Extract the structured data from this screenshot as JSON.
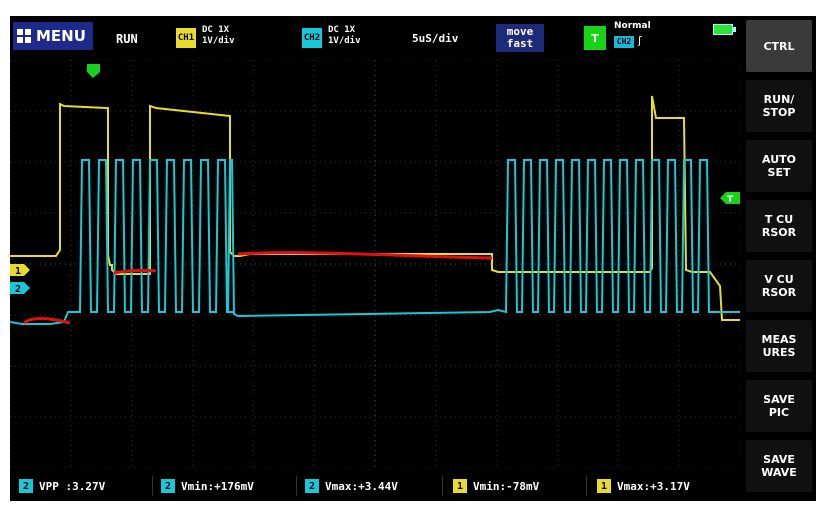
{
  "header": {
    "menu_label": "MENU",
    "run_state": "RUN",
    "ch1": {
      "tag": "CH1",
      "coupling": "DC  1X",
      "scale": "1V/div"
    },
    "ch2": {
      "tag": "CH2",
      "coupling": "DC  1X",
      "scale": "1V/div"
    },
    "timebase": "5uS/div",
    "move": {
      "line1": "move",
      "line2": "fast"
    },
    "trigger": {
      "icon": "T",
      "mode": "Normal",
      "source": "CH2",
      "edge": "ʃ"
    }
  },
  "sidebar": {
    "items": [
      {
        "label": "CTRL"
      },
      {
        "label": "RUN/\nSTOP"
      },
      {
        "label": "AUTO\nSET"
      },
      {
        "label": "T CU\nRSOR"
      },
      {
        "label": "V CU\nRSOR"
      },
      {
        "label": "MEAS\nURES"
      },
      {
        "label": "SAVE\nPIC"
      },
      {
        "label": "SAVE\nWAVE"
      }
    ]
  },
  "markers": {
    "ch1": "1",
    "ch2": "2",
    "trig_level": "T"
  },
  "measurements": [
    {
      "ch": "2",
      "text": "VPP :3.27V"
    },
    {
      "ch": "2",
      "text": "Vmin:+176mV"
    },
    {
      "ch": "2",
      "text": "Vmax:+3.44V"
    },
    {
      "ch": "1",
      "text": "Vmin:-78mV"
    },
    {
      "ch": "1",
      "text": "Vmax:+3.17V"
    }
  ],
  "colors": {
    "ch1": "#e8dc2a",
    "ch2": "#19c8d8",
    "annotation": "#e01010",
    "grid": "#3a3a3a"
  }
}
